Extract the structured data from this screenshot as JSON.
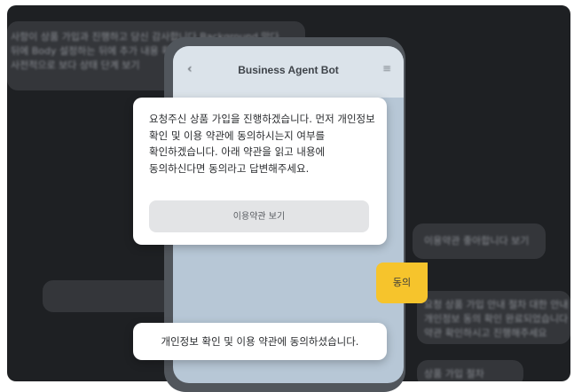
{
  "background": {
    "lines": [
      "사항이 상품 가입과 진행하고 당신 감사합니다 Background 맞다",
      "뒤에 Body 설정하는 뒤에 추가 내용 확인",
      "사전적으로 보다 상태 단계 보기"
    ],
    "right_label_1": "이용약관 좋아합니다 보기",
    "right_line_1": "요청 상품 가입 안내 절차 대한 안내",
    "right_line_2": "개인정보 동의 확인 완료되었습니다 대해",
    "right_line_3": "약관 확인하시고 진행해주세요",
    "right_line_4": "상품 가입 절차"
  },
  "phone": {
    "back_icon": "‹",
    "title": "Business Agent Bot",
    "menu_icon": "≡"
  },
  "dialog": {
    "message": "요청주신 상품 가입을 진행하겠습니다. 먼저 개인정보 확인 및 이용 약관에 동의하시는지 여부를 확인하겠습니다. 아래 약관을 읽고 내용에 동의하신다면 동의라고 답변해주세요.",
    "button_label": "이용약관 보기"
  },
  "agree_bubble": {
    "label": "동의"
  },
  "consent_bubble": {
    "text": "개인정보 확인 및 이용 약관에 동의하셨습니다."
  },
  "colors": {
    "frame_bg": "#1e2023",
    "phone_screen": "#b7c7d6",
    "accent_yellow": "#f6c42c",
    "dialog_bg": "#ffffff"
  }
}
